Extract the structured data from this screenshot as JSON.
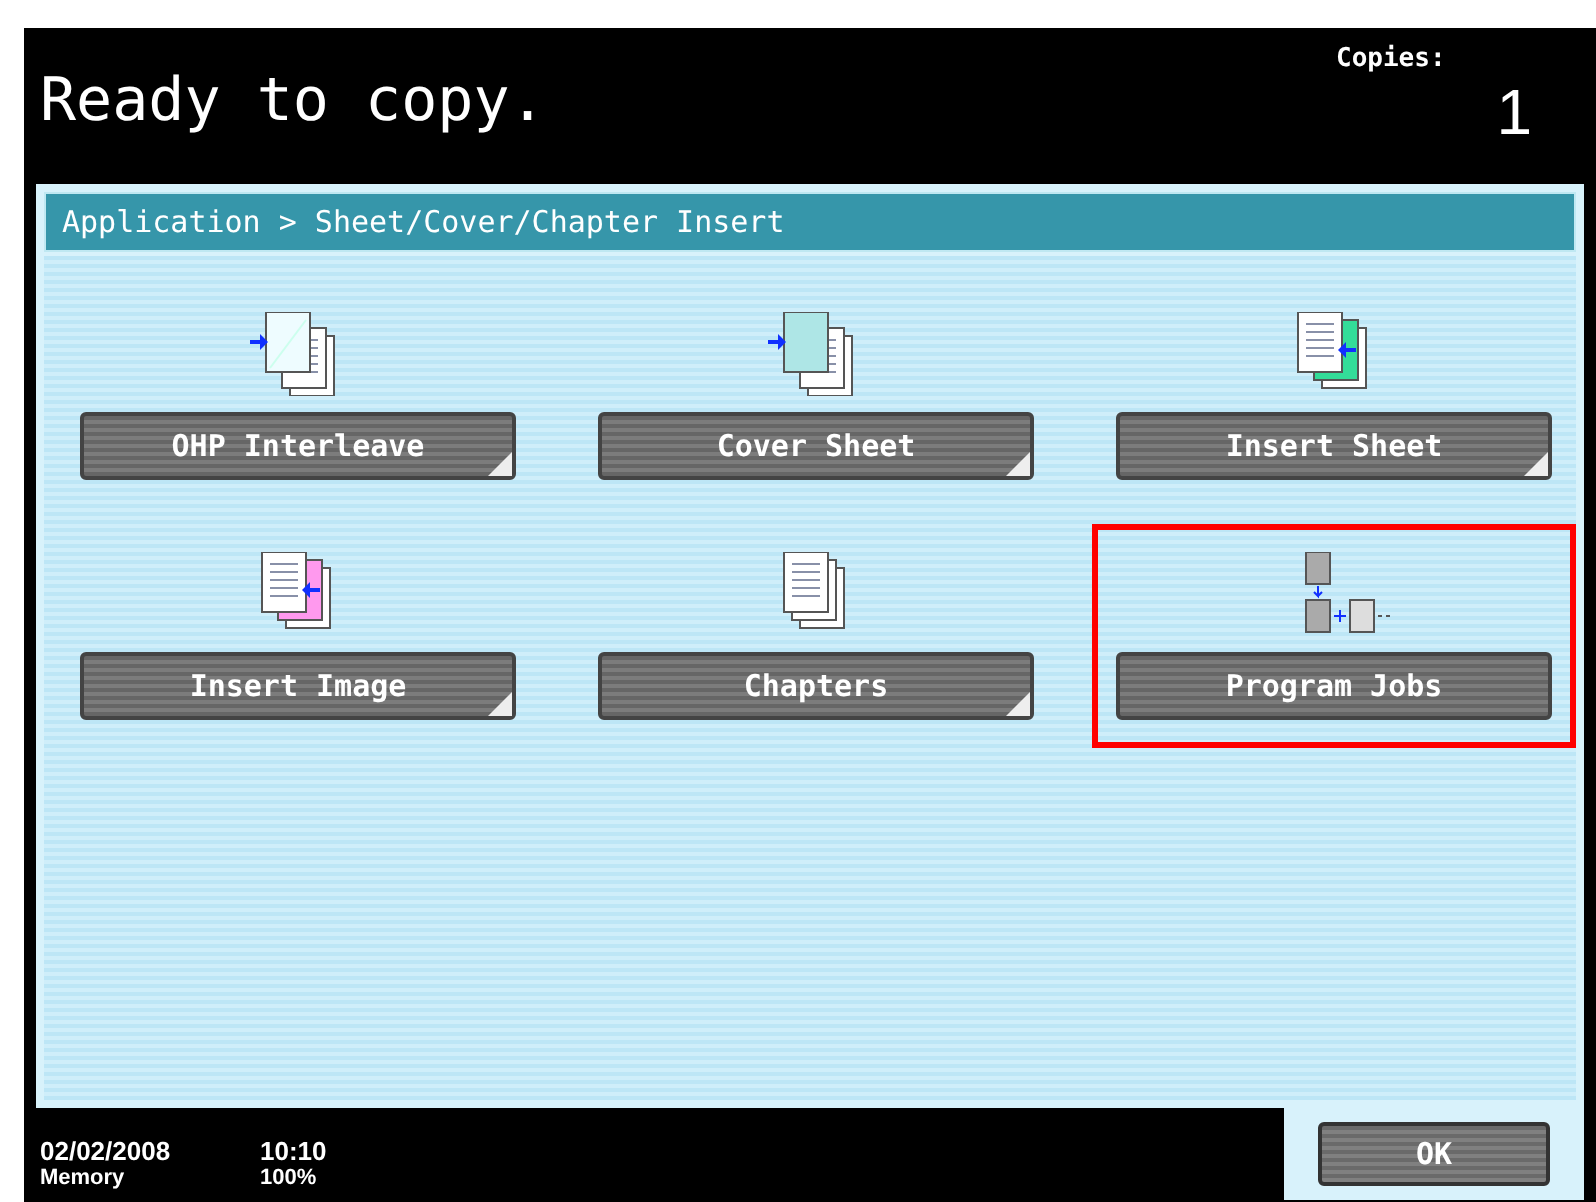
{
  "header": {
    "status": "Ready to copy.",
    "copies_label": "Copies:",
    "copies": "1"
  },
  "breadcrumb": "Application > Sheet/Cover/Chapter Insert",
  "functions": [
    {
      "label": "OHP Interleave",
      "kind": "ohp",
      "corner_mark": true,
      "highlighted": false
    },
    {
      "label": "Cover Sheet",
      "kind": "cover",
      "corner_mark": true,
      "highlighted": false
    },
    {
      "label": "Insert Sheet",
      "kind": "insert-sheet",
      "corner_mark": true,
      "highlighted": false
    },
    {
      "label": "Insert Image",
      "kind": "insert-image",
      "corner_mark": true,
      "highlighted": false
    },
    {
      "label": "Chapters",
      "kind": "chapters",
      "corner_mark": true,
      "highlighted": false
    },
    {
      "label": "Program Jobs",
      "kind": "program",
      "corner_mark": false,
      "highlighted": true
    }
  ],
  "status_bar": {
    "date": "02/02/2008",
    "time": "10:10",
    "memory_label": "Memory",
    "memory": "100%"
  },
  "ok_button": "OK"
}
